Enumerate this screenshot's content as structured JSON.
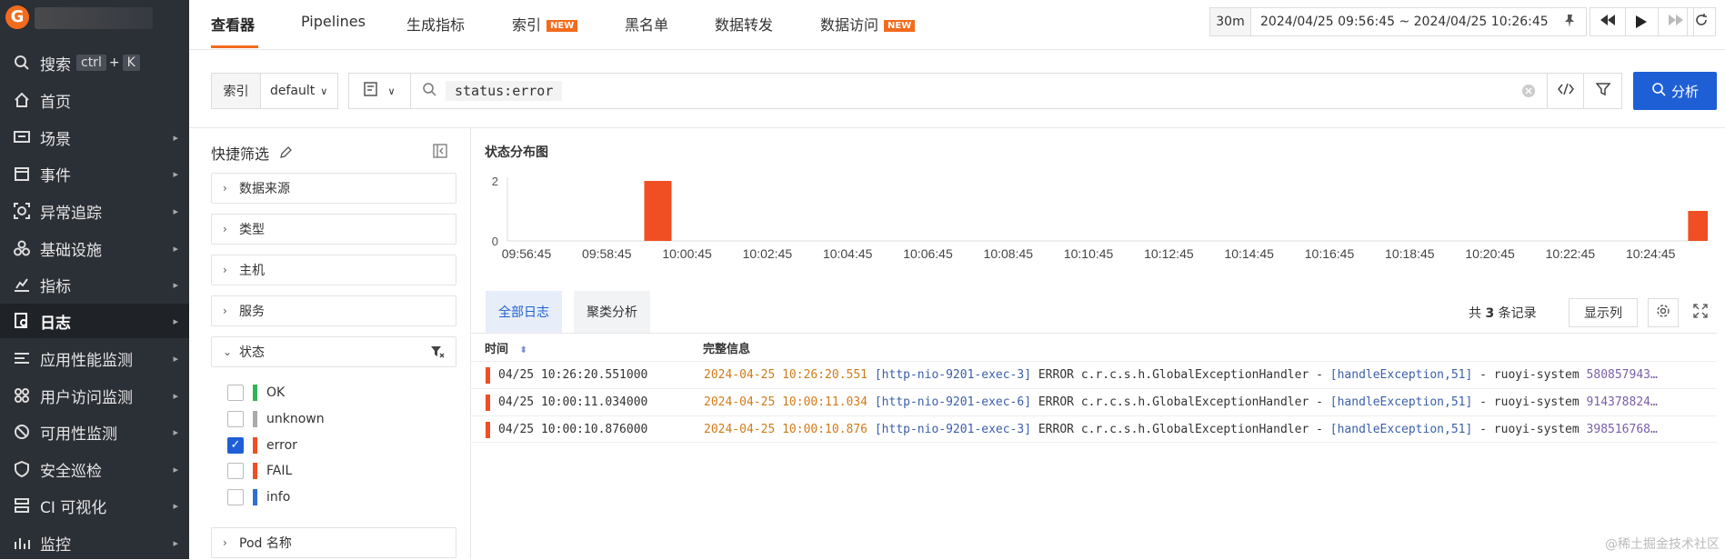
{
  "sidebar": {
    "items": [
      {
        "label": "搜索",
        "icon": "search-icon",
        "shortcut": [
          "ctrl",
          "+",
          "K"
        ]
      },
      {
        "label": "首页",
        "icon": "home-icon"
      },
      {
        "label": "场景",
        "icon": "dashboard-icon"
      },
      {
        "label": "事件",
        "icon": "calendar-icon"
      },
      {
        "label": "异常追踪",
        "icon": "bug-target-icon"
      },
      {
        "label": "基础设施",
        "icon": "infrastructure-icon"
      },
      {
        "label": "指标",
        "icon": "metrics-icon"
      },
      {
        "label": "日志",
        "icon": "log-search-icon"
      },
      {
        "label": "应用性能监测",
        "icon": "apm-icon"
      },
      {
        "label": "用户访问监测",
        "icon": "rum-icon"
      },
      {
        "label": "可用性监测",
        "icon": "availability-icon"
      },
      {
        "label": "安全巡检",
        "icon": "shield-icon"
      },
      {
        "label": "CI 可视化",
        "icon": "ci-icon"
      },
      {
        "label": "监控",
        "icon": "monitor-icon"
      }
    ]
  },
  "topnav": {
    "tabs": [
      {
        "label": "查看器"
      },
      {
        "label": "Pipelines"
      },
      {
        "label": "生成指标"
      },
      {
        "label": "索引",
        "badge": "NEW"
      },
      {
        "label": "黑名单"
      },
      {
        "label": "数据转发"
      },
      {
        "label": "数据访问",
        "badge": "NEW"
      }
    ],
    "time_quick": "30m",
    "time_range": "2024/04/25 09:56:45 ~ 2024/04/25 10:26:45"
  },
  "search": {
    "index_label": "索引",
    "index_value": "default",
    "query": "status:error",
    "analyze_label": "分析"
  },
  "quick_filter": {
    "title": "快捷筛选",
    "groups": [
      "数据来源",
      "类型",
      "主机",
      "服务"
    ],
    "status_group": "状态",
    "status_options": [
      {
        "label": "OK",
        "color": "#2fb554",
        "checked": false
      },
      {
        "label": "unknown",
        "color": "#aaaaaa",
        "checked": false
      },
      {
        "label": "error",
        "color": "#f04e23",
        "checked": true
      },
      {
        "label": "FAIL",
        "color": "#f04e23",
        "checked": false
      },
      {
        "label": "info",
        "color": "#2f6fd6",
        "checked": false
      }
    ],
    "pod_group": "Pod 名称"
  },
  "chart_data": {
    "type": "bar",
    "title": "状态分布图",
    "x": [
      "09:56:45",
      "09:58:45",
      "10:00:45",
      "10:02:45",
      "10:04:45",
      "10:06:45",
      "10:08:45",
      "10:10:45",
      "10:12:45",
      "10:14:45",
      "10:16:45",
      "10:18:45",
      "10:20:45",
      "10:22:45",
      "10:24:45"
    ],
    "bars": [
      {
        "time": "10:00:00",
        "value": 2
      },
      {
        "time": "10:26:00",
        "value": 1
      }
    ],
    "yticks": [
      0,
      2
    ],
    "ylim": [
      0,
      2
    ],
    "bar_color": "#f04e23",
    "grid": false
  },
  "logs": {
    "tabs": [
      "全部日志",
      "聚类分析"
    ],
    "total_prefix": "共",
    "total_count": "3",
    "total_suffix": "条记录",
    "display_columns": "显示列",
    "columns": [
      "时间",
      "完整信息"
    ],
    "rows": [
      {
        "time": "04/25 10:26:20.551000",
        "ts": "2024-04-25 10:26:20.551",
        "thread": "[http-nio-9201-exec-3]",
        "text": " ERROR c.r.c.s.h.GlobalExceptionHandler - ",
        "method": "[handleException,51]",
        "text2": " - ruoyi-system ",
        "id": "580857943…"
      },
      {
        "time": "04/25 10:00:11.034000",
        "ts": "2024-04-25 10:00:11.034",
        "thread": "[http-nio-9201-exec-6]",
        "text": " ERROR c.r.c.s.h.GlobalExceptionHandler - ",
        "method": "[handleException,51]",
        "text2": " - ruoyi-system ",
        "id": "914378824…"
      },
      {
        "time": "04/25 10:00:10.876000",
        "ts": "2024-04-25 10:00:10.876",
        "thread": "[http-nio-9201-exec-3]",
        "text": " ERROR c.r.c.s.h.GlobalExceptionHandler - ",
        "method": "[handleException,51]",
        "text2": " - ruoyi-system ",
        "id": "398516768…"
      }
    ]
  },
  "watermark": "@稀土掘金技术社区"
}
